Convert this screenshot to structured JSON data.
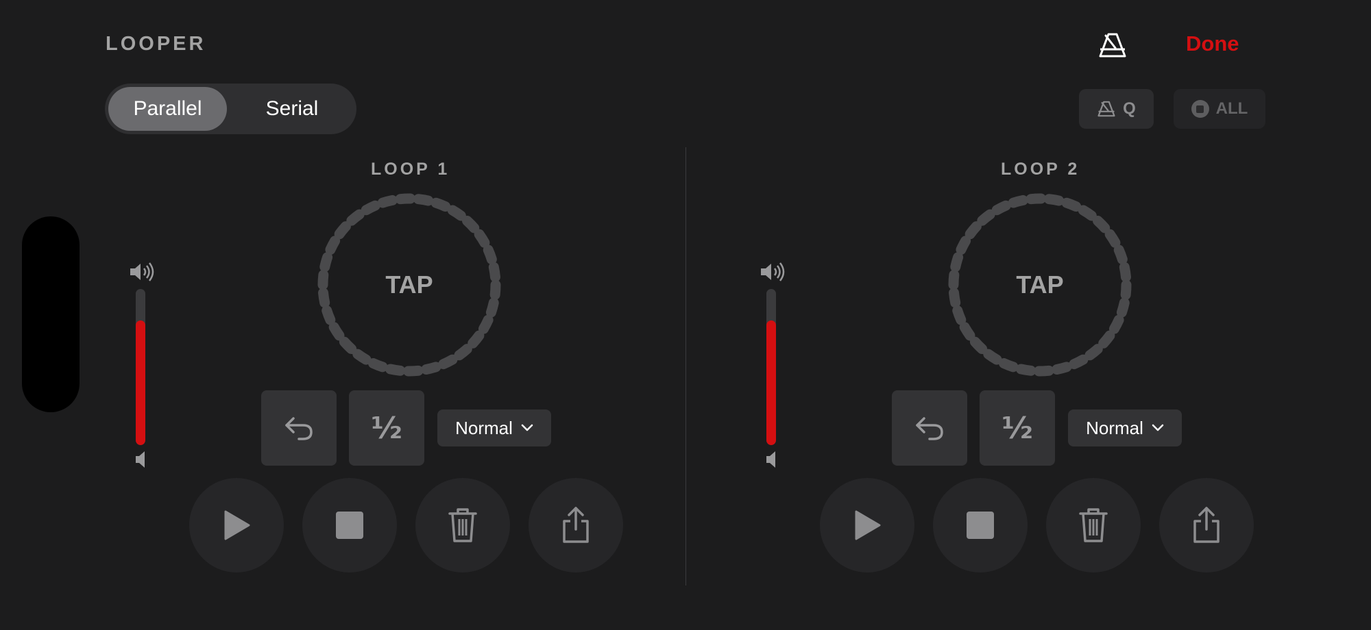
{
  "header": {
    "title": "LOOPER",
    "metronome_icon": "metronome-icon",
    "done_label": "Done"
  },
  "mode": {
    "options": [
      "Parallel",
      "Serial"
    ],
    "selected": "Parallel"
  },
  "toolbar": {
    "quantize_label": "Q",
    "quantize_icon": "metronome-icon",
    "stop_all_label": "ALL",
    "stop_all_icon": "stop-circle-icon"
  },
  "loops": [
    {
      "title": "LOOP 1",
      "tap_label": "TAP",
      "volume_level": 0.8,
      "half_label": "½",
      "speed_value": "Normal",
      "controls": [
        "play-icon",
        "stop-icon",
        "trash-icon",
        "share-icon"
      ]
    },
    {
      "title": "LOOP 2",
      "tap_label": "TAP",
      "volume_level": 0.8,
      "half_label": "½",
      "speed_value": "Normal",
      "controls": [
        "play-icon",
        "stop-icon",
        "trash-icon",
        "share-icon"
      ]
    }
  ],
  "colors": {
    "accent": "#d40f11",
    "background": "#1c1c1d",
    "ring": "#4a4a4c"
  }
}
